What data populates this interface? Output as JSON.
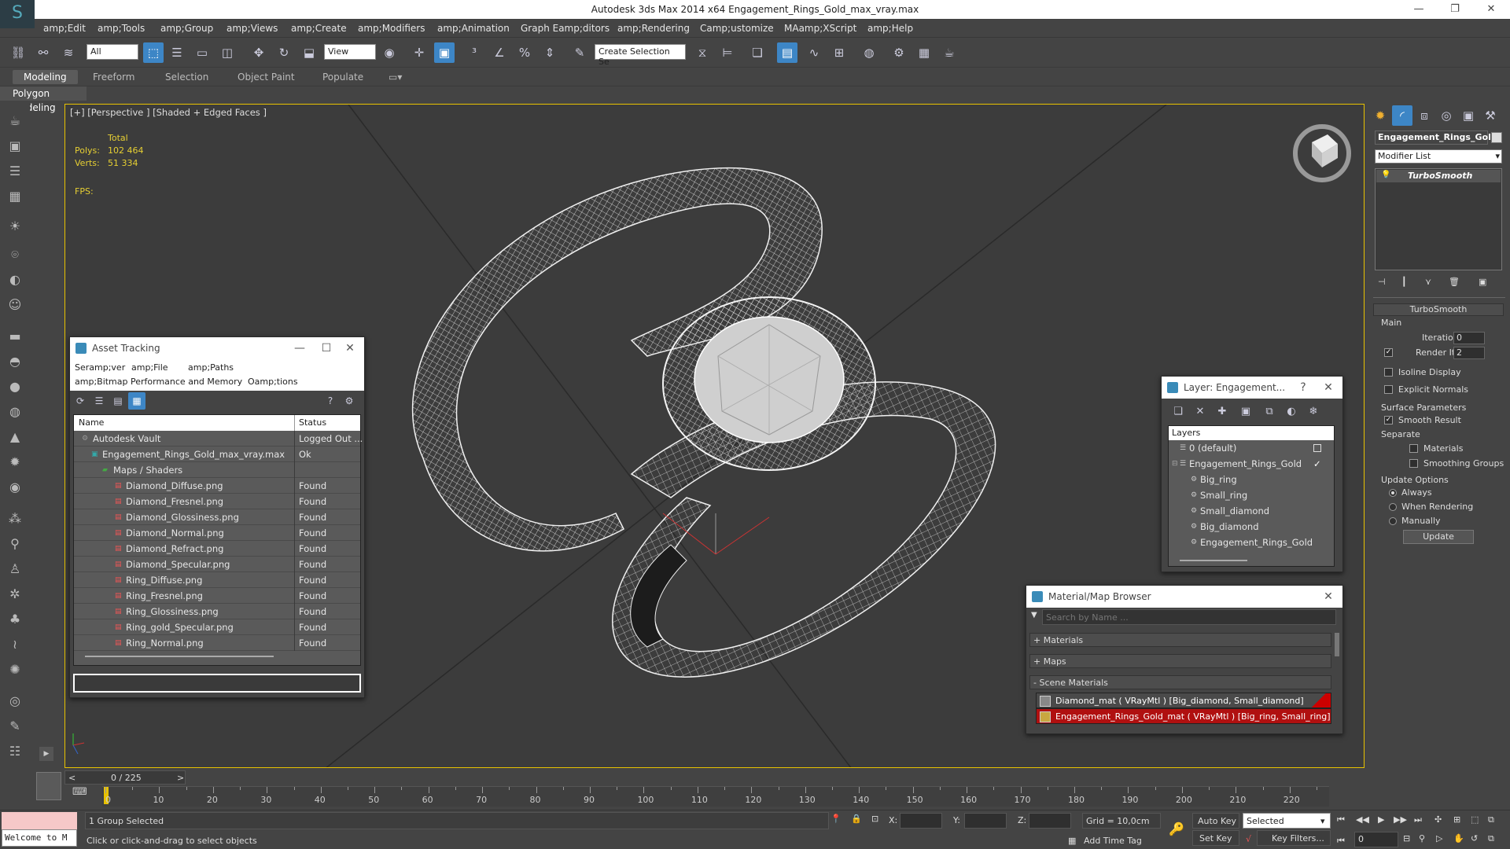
{
  "window": {
    "title": "Autodesk 3ds Max  2014 x64     Engagement_Rings_Gold_max_vray.max",
    "minimize": "—",
    "maximize": "❐",
    "close": "✕"
  },
  "menu": [
    "amp;Edit",
    "amp;Tools",
    "amp;Group",
    "amp;Views",
    "amp;Create",
    "amp;Modifiers",
    "amp;Animation",
    "Graph Eamp;ditors",
    "amp;Rendering",
    "Camp;ustomize",
    "MAamp;XScript",
    "amp;Help"
  ],
  "toolbar": {
    "filter": "All",
    "ref_coord": "View",
    "selection_set": "Create Selection Se"
  },
  "ribbon": {
    "tabs": [
      "Modeling",
      "Freeform",
      "Selection",
      "Object Paint",
      "Populate"
    ],
    "sub": "Polygon Modeling"
  },
  "viewport": {
    "label": "[+] [Perspective ] [Shaded + Edged Faces ]",
    "stats": {
      "total_label": "Total",
      "polys_label": "Polys:",
      "polys": "102 464",
      "verts_label": "Verts:",
      "verts": "51 334",
      "fps_label": "FPS:"
    }
  },
  "asset_tracking": {
    "title": "Asset Tracking",
    "menu": [
      "Seramp;ver",
      "amp;File",
      "amp;Paths"
    ],
    "menu2": [
      "amp;Bitmap Performance and Memory",
      "Oamp;tions"
    ],
    "col_name": "Name",
    "col_status": "Status",
    "rows": [
      {
        "name": "Autodesk Vault",
        "status": "Logged Out ..."
      },
      {
        "name": "Engagement_Rings_Gold_max_vray.max",
        "status": "Ok"
      },
      {
        "name": "Maps / Shaders",
        "status": ""
      },
      {
        "name": "Diamond_Diffuse.png",
        "status": "Found"
      },
      {
        "name": "Diamond_Fresnel.png",
        "status": "Found"
      },
      {
        "name": "Diamond_Glossiness.png",
        "status": "Found"
      },
      {
        "name": "Diamond_Normal.png",
        "status": "Found"
      },
      {
        "name": "Diamond_Refract.png",
        "status": "Found"
      },
      {
        "name": "Diamond_Specular.png",
        "status": "Found"
      },
      {
        "name": "Ring_Diffuse.png",
        "status": "Found"
      },
      {
        "name": "Ring_Fresnel.png",
        "status": "Found"
      },
      {
        "name": "Ring_Glossiness.png",
        "status": "Found"
      },
      {
        "name": "Ring_gold_Specular.png",
        "status": "Found"
      },
      {
        "name": "Ring_Normal.png",
        "status": "Found"
      }
    ]
  },
  "layer_panel": {
    "title": "Layer: Engagement...",
    "help": "?",
    "header": "Layers",
    "rows": [
      "0 (default)",
      "Engagement_Rings_Gold",
      "Big_ring",
      "Small_ring",
      "Small_diamond",
      "Big_diamond",
      "Engagement_Rings_Gold"
    ]
  },
  "material_browser": {
    "title": "Material/Map Browser",
    "search_placeholder": "Search by Name ...",
    "sections": [
      "+ Materials",
      "+ Maps",
      "- Scene Materials"
    ],
    "materials": [
      "Diamond_mat  ( VRayMtl ) [Big_diamond, Small_diamond]",
      "Engagement_Rings_Gold_mat  ( VRayMtl ) [Big_ring, Small_ring]"
    ]
  },
  "command_panel": {
    "object_name": "Engagement_Rings_Gold",
    "modifier_list": "Modifier List",
    "stack_item": "TurboSmooth",
    "rollout": "TurboSmooth",
    "main": "Main",
    "iterations_label": "Iterations:",
    "iterations": "0",
    "render_iters_label": "Render Iters:",
    "render_iters": "2",
    "isoline": "Isoline Display",
    "explicit": "Explicit Normals",
    "surface": "Surface Parameters",
    "smooth": "Smooth Result",
    "separate": "Separate",
    "materials": "Materials",
    "smoothing": "Smoothing Groups",
    "update_options": "Update Options",
    "always": "Always",
    "when_rendering": "When Rendering",
    "manually": "Manually",
    "update_btn": "Update"
  },
  "timeline": {
    "frame": "0 / 225",
    "ticks": [
      "0",
      "10",
      "20",
      "30",
      "40",
      "50",
      "60",
      "70",
      "80",
      "90",
      "100",
      "110",
      "120",
      "130",
      "140",
      "150",
      "160",
      "170",
      "180",
      "190",
      "200",
      "210",
      "220"
    ]
  },
  "status": {
    "welcome": "Welcome to M",
    "selected": "1 Group Selected",
    "prompt": "Click or click-and-drag to select objects",
    "x": "X:",
    "y": "Y:",
    "z": "Z:",
    "grid": "Grid = 10,0cm",
    "auto_key": "Auto Key",
    "set_key": "Set Key",
    "selected_dd": "Selected",
    "key_filters": "Key Filters...",
    "add_time_tag": "Add Time Tag",
    "frame_val": "0"
  }
}
